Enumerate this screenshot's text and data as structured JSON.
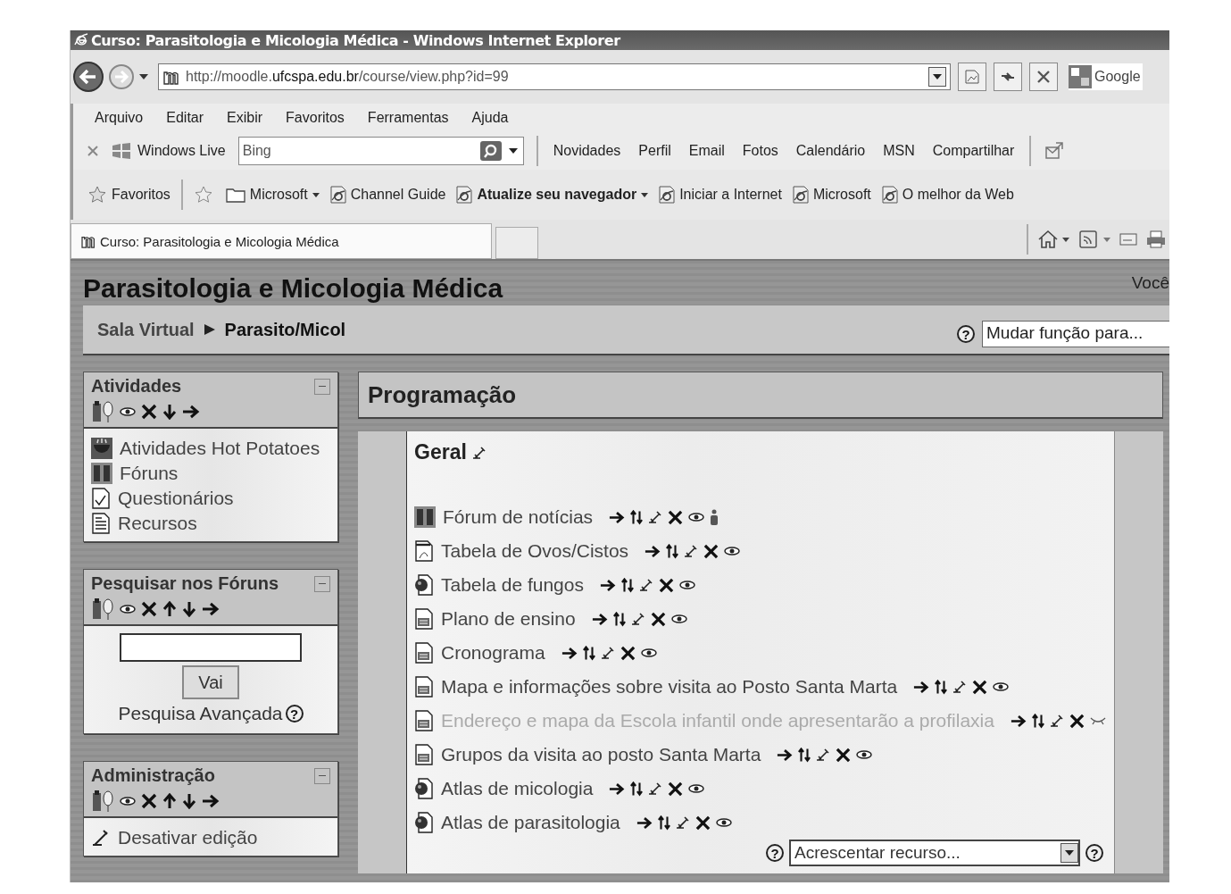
{
  "window": {
    "title": "Curso: Parasitologia e Micologia Médica - Windows Internet Explorer"
  },
  "address_bar": {
    "url_start": "http://moodle.",
    "url_domain": "ufcspa.edu.br",
    "url_end": "/course/view.php?id=99",
    "search_provider": "Google"
  },
  "menu": [
    "Arquivo",
    "Editar",
    "Exibir",
    "Favoritos",
    "Ferramentas",
    "Ajuda"
  ],
  "live_toolbar": {
    "brand": "Windows Live",
    "search_value": "Bing",
    "links": [
      "Novidades",
      "Perfil",
      "Email",
      "Fotos",
      "Calendário",
      "MSN",
      "Compartilhar"
    ]
  },
  "favorites_bar": {
    "label": "Favoritos",
    "items": [
      {
        "label": "Microsoft",
        "kind": "folder",
        "emphasized": false,
        "has_menu": true
      },
      {
        "label": "Channel Guide",
        "kind": "page",
        "emphasized": false,
        "has_menu": false
      },
      {
        "label": "Atualize seu navegador",
        "kind": "page",
        "emphasized": true,
        "has_menu": true
      },
      {
        "label": "Iniciar a Internet",
        "kind": "page",
        "emphasized": false,
        "has_menu": false
      },
      {
        "label": "Microsoft",
        "kind": "page",
        "emphasized": false,
        "has_menu": false
      },
      {
        "label": "O melhor da Web",
        "kind": "page",
        "emphasized": false,
        "has_menu": false
      }
    ]
  },
  "tab": {
    "title": "Curso: Parasitologia e Micologia Médica"
  },
  "page": {
    "title": "Parasitologia e Micologia Médica",
    "user_text": "Você",
    "breadcrumb": [
      "Sala Virtual",
      "Parasito/Micol"
    ],
    "help_mark": "?",
    "role_select": "Mudar função para..."
  },
  "blocks": [
    {
      "kind": "list",
      "title": "Atividades",
      "controls": [
        {
          "kind": "roles"
        },
        {
          "kind": "hide"
        },
        {
          "kind": "delete"
        },
        {
          "kind": "down"
        },
        {
          "kind": "right"
        }
      ],
      "items": [
        {
          "label": "Atividades Hot Potatoes",
          "kind": "hotpot"
        },
        {
          "label": "Fóruns",
          "kind": "forum"
        },
        {
          "label": "Questionários",
          "kind": "quiz"
        },
        {
          "label": "Recursos",
          "kind": "resource"
        }
      ]
    },
    {
      "kind": "search",
      "title": "Pesquisar nos Fóruns",
      "controls": [
        {
          "kind": "roles"
        },
        {
          "kind": "hide"
        },
        {
          "kind": "delete"
        },
        {
          "kind": "up"
        },
        {
          "kind": "down"
        },
        {
          "kind": "right"
        }
      ],
      "button": "Vai",
      "link": "Pesquisa Avançada",
      "help_mark": "?"
    },
    {
      "kind": "list",
      "title": "Administração",
      "controls": [
        {
          "kind": "roles"
        },
        {
          "kind": "hide"
        },
        {
          "kind": "delete"
        },
        {
          "kind": "up"
        },
        {
          "kind": "down"
        },
        {
          "kind": "right"
        }
      ],
      "items": [
        {
          "label": "Desativar edição",
          "kind": "edit"
        }
      ]
    }
  ],
  "main": {
    "heading": "Programação",
    "section": "Geral",
    "activities": [
      {
        "label": "Fórum de notícias",
        "kind": "forum",
        "hidden": false,
        "groups": true
      },
      {
        "label": "Tabela de Ovos/Cistos",
        "kind": "pdf",
        "hidden": false,
        "groups": false
      },
      {
        "label": "Tabela de fungos",
        "kind": "web",
        "hidden": false,
        "groups": false
      },
      {
        "label": "Plano de ensino",
        "kind": "word",
        "hidden": false,
        "groups": false
      },
      {
        "label": "Cronograma",
        "kind": "word",
        "hidden": false,
        "groups": false
      },
      {
        "label": "Mapa e informações sobre visita ao Posto Santa Marta",
        "kind": "word",
        "hidden": false,
        "groups": false
      },
      {
        "label": "Endereço e mapa da Escola infantil onde apresentarão a profilaxia",
        "kind": "word",
        "hidden": true,
        "groups": false
      },
      {
        "label": "Grupos da visita ao posto Santa Marta",
        "kind": "word",
        "hidden": false,
        "groups": false
      },
      {
        "label": "Atlas de micologia",
        "kind": "web",
        "hidden": false,
        "groups": false
      },
      {
        "label": "Atlas de parasitologia",
        "kind": "web",
        "hidden": false,
        "groups": false
      }
    ],
    "help_marks": [
      "?",
      "?"
    ],
    "add_resource": "Acrescentar recurso..."
  }
}
